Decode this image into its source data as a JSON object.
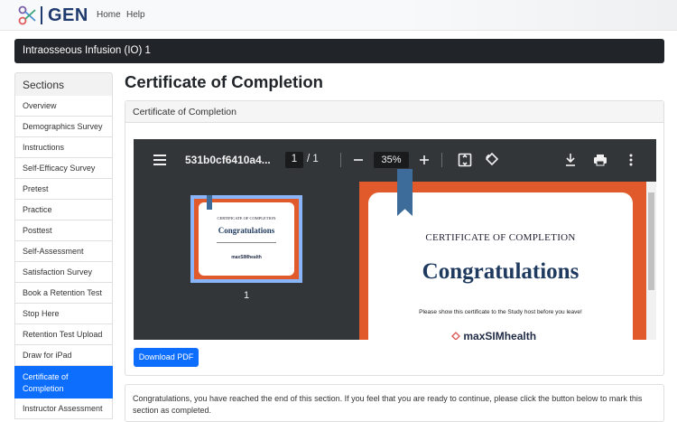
{
  "nav": {
    "brand": "GEN",
    "links": [
      "Home",
      "Help"
    ]
  },
  "course": {
    "title": "Intraosseous Infusion (IO) 1"
  },
  "sidebar": {
    "heading": "Sections",
    "items": [
      {
        "label": "Overview"
      },
      {
        "label": "Demographics Survey"
      },
      {
        "label": "Instructions"
      },
      {
        "label": "Self-Efficacy Survey"
      },
      {
        "label": "Pretest"
      },
      {
        "label": "Practice"
      },
      {
        "label": "Posttest"
      },
      {
        "label": "Self-Assessment"
      },
      {
        "label": "Satisfaction Survey"
      },
      {
        "label": "Book a Retention Test"
      },
      {
        "label": "Stop Here"
      },
      {
        "label": "Retention Test Upload"
      },
      {
        "label": "Draw for iPad"
      },
      {
        "label": "Certificate of Completion",
        "active": true
      },
      {
        "label": "Instructor Assessment"
      }
    ]
  },
  "main": {
    "title": "Certificate of Completion",
    "card_header": "Certificate of Completion",
    "download_label": "Download PDF",
    "notice": "Congratulations, you have reached the end of this section. If you feel that you are ready to continue, please click the button below to mark this section as completed."
  },
  "pdf_viewer": {
    "filename": "531b0cf6410a4...",
    "page_current": "1",
    "page_total": "/ 1",
    "zoom": "35%",
    "thumbnail_page": "1",
    "certificate": {
      "heading": "CERTIFICATE OF COMPLETION",
      "congrats": "Congratulations",
      "message": "Please show this certificate to the Study host before you leave!",
      "logo_text": "maxSIMhealth"
    }
  },
  "colors": {
    "primary": "#0d6efd",
    "dark_bar": "#212529",
    "brand": "#1e3a6e",
    "certificate_border": "#e05a2b",
    "ribbon": "#3d6b9a"
  }
}
